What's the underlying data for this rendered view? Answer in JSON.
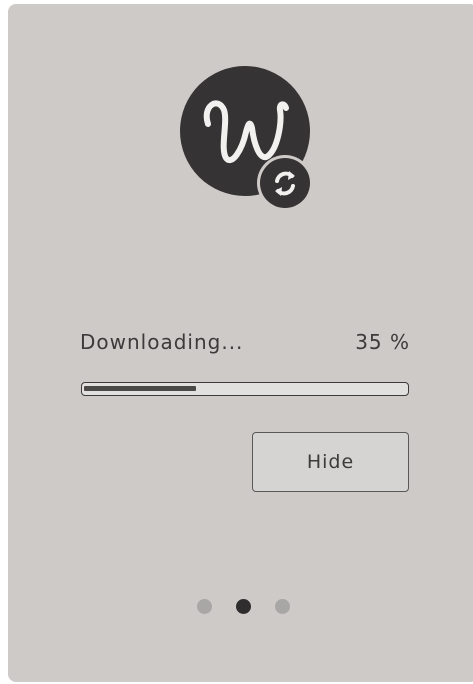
{
  "app": {
    "logo_icon": "w-script-logo-icon",
    "badge_icon": "sync-refresh-icon"
  },
  "download": {
    "status_label": "Downloading...",
    "percent_text": "35 %",
    "progress_fraction": 0.35
  },
  "actions": {
    "hide_label": "Hide"
  },
  "pagination": {
    "pages": 3,
    "active_index": 1
  },
  "colors": {
    "panel_background": "#cdcac8",
    "logo_dark": "#353333",
    "text": "#3c3a3a",
    "dot_active": "#2f2d2d",
    "dot_inactive": "#a9a7a6"
  }
}
